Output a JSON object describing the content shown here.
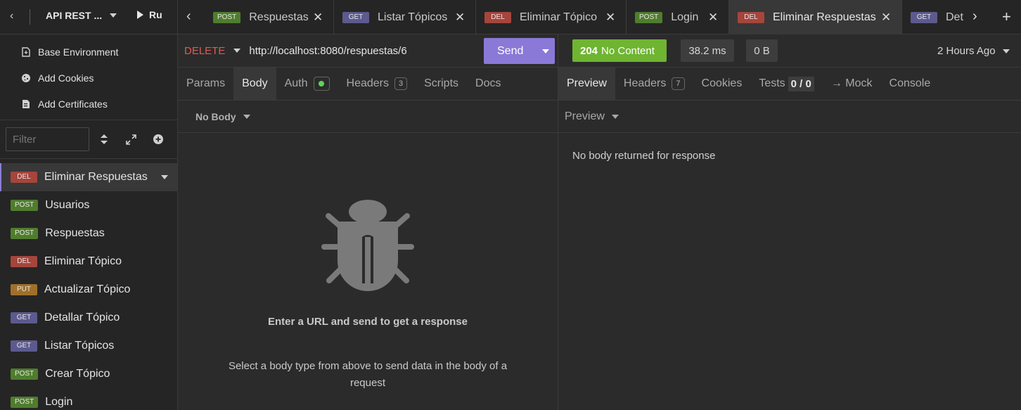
{
  "sidebar": {
    "project": "API REST ...",
    "run": "Ru",
    "env_items": [
      {
        "label": "Base Environment",
        "icon": "environment-icon"
      },
      {
        "label": "Add Cookies",
        "icon": "cookie-icon"
      },
      {
        "label": "Add Certificates",
        "icon": "certificate-icon"
      }
    ],
    "filter_placeholder": "Filter",
    "requests": [
      {
        "method": "DEL",
        "name": "Eliminar Respuestas"
      },
      {
        "method": "POST",
        "name": "Usuarios"
      },
      {
        "method": "POST",
        "name": "Respuestas"
      },
      {
        "method": "DEL",
        "name": "Eliminar Tópico"
      },
      {
        "method": "PUT",
        "name": "Actualizar Tópico"
      },
      {
        "method": "GET",
        "name": "Detallar Tópico"
      },
      {
        "method": "GET",
        "name": "Listar Tópicos"
      },
      {
        "method": "POST",
        "name": "Crear Tópico"
      },
      {
        "method": "POST",
        "name": "Login"
      }
    ]
  },
  "tabs": [
    {
      "method": "POST",
      "name": "Respuestas"
    },
    {
      "method": "GET",
      "name": "Listar Tópicos"
    },
    {
      "method": "DEL",
      "name": "Eliminar Tópico"
    },
    {
      "method": "POST",
      "name": "Login"
    },
    {
      "method": "DEL",
      "name": "Eliminar Respuestas"
    },
    {
      "method": "GET",
      "name": "Det"
    }
  ],
  "request": {
    "method": "DELETE",
    "url": "http://localhost:8080/respuestas/6",
    "send_label": "Send",
    "tabs": {
      "params": "Params",
      "body": "Body",
      "auth": "Auth",
      "headers": "Headers",
      "headers_count": "3",
      "scripts": "Scripts",
      "docs": "Docs"
    },
    "body_type": "No Body",
    "empty_title": "Enter a URL and send to get a response",
    "empty_text": "Select a body type from above to send data in the body of a request"
  },
  "response": {
    "status_code": "204",
    "status_text": "No Content",
    "time": "38.2 ms",
    "size": "0 B",
    "age": "2 Hours Ago",
    "tabs": {
      "preview": "Preview",
      "headers": "Headers",
      "headers_count": "7",
      "cookies": "Cookies",
      "tests": "Tests",
      "tests_count": "0 / 0",
      "mock": "→ Mock",
      "console": "Console"
    },
    "preview_mode": "Preview",
    "body_message": "No body returned for response"
  },
  "colors": {
    "accent": "#8a79d6",
    "success": "#6fb531",
    "delete": "#e05a4f",
    "post": "#4f7d2d",
    "get": "#5c5a8e",
    "del": "#a6453c",
    "put": "#a0702a"
  }
}
